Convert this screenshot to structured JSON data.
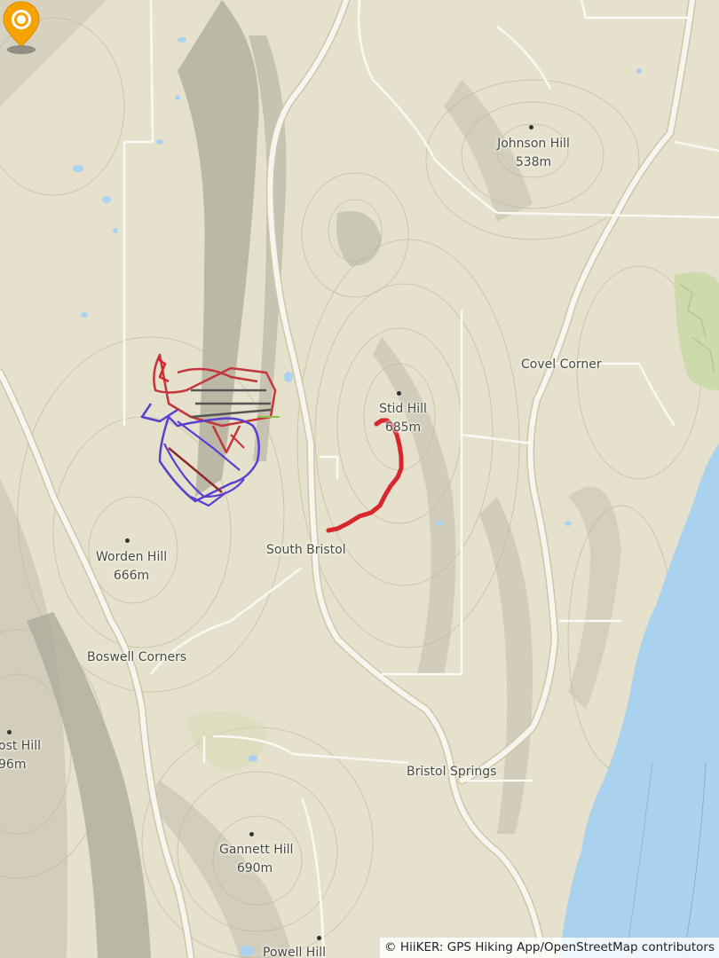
{
  "map": {
    "place_labels": {
      "johnson_hill": {
        "name": "Johnson Hill",
        "elevation": "538m"
      },
      "covel_corner": {
        "name": "Covel Corner"
      },
      "stid_hill": {
        "name": "Stid Hill",
        "elevation": "685m"
      },
      "south_bristol": {
        "name": "South Bristol"
      },
      "worden_hill": {
        "name": "Worden Hill",
        "elevation": "666m"
      },
      "boswell_corners": {
        "name": "Boswell Corners"
      },
      "frost_hill": {
        "name": "ost Hill",
        "elevation": "96m"
      },
      "bristol_springs": {
        "name": "Bristol Springs"
      },
      "gannett_hill": {
        "name": "Gannett Hill",
        "elevation": "690m"
      },
      "powell_hill": {
        "name": "Powell Hill"
      }
    },
    "attribution": "© HiiKER: GPS Hiking App/OpenStreetMap contributors",
    "colors": {
      "land": "#e6e1cc",
      "water": "#a9d2ee",
      "road": "#f7f5ee",
      "road_casing": "#cfc6a6",
      "trail_red": "#d8262e",
      "trail_purple": "#5a3fd0",
      "pin": "#f5a300"
    },
    "icons": {
      "trailhead_pin": "map-pin-icon"
    }
  }
}
